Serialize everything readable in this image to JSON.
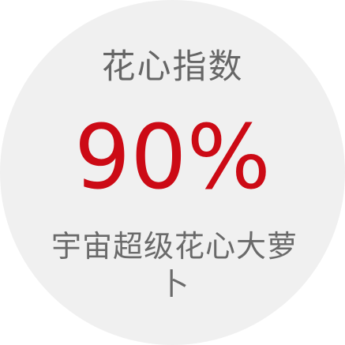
{
  "card": {
    "title": "花心指数",
    "value": "90%",
    "subtitle": "宇宙超级花心大萝卜"
  },
  "colors": {
    "background": "#f0f0f0",
    "title": "#666666",
    "value": "#cc0a15",
    "subtitle": "#6a6a6a"
  }
}
